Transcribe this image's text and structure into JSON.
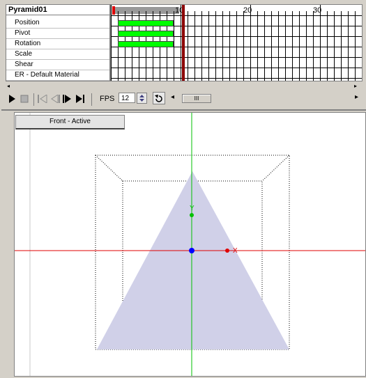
{
  "timeline": {
    "object_name": "Pyramid01",
    "tracks": [
      "Position",
      "Pivot",
      "Rotation",
      "Scale",
      "Shear",
      "ER - Default Material"
    ],
    "ruler_labels": [
      "10",
      "20",
      "30"
    ],
    "keyframe_tracks": [
      "Position",
      "Pivot",
      "Rotation"
    ]
  },
  "transport": {
    "fps_label": "FPS",
    "fps_value": "12",
    "scroll_thumb_glyph": "III",
    "icons": [
      "play-icon",
      "stop-icon",
      "go-to-start-icon",
      "prev-key-icon",
      "next-key-icon",
      "go-to-end-icon",
      "loop-icon",
      "scroll-left-icon",
      "scroll-right-icon"
    ]
  },
  "viewport": {
    "title": "Front - Active",
    "axis_labels": {
      "x": "X",
      "y": "Y"
    },
    "colors": {
      "pyramid_fill": "#d0d0e8",
      "x_axis": "#e00000",
      "y_axis": "#00c000",
      "pivot": "#0000ff"
    }
  }
}
